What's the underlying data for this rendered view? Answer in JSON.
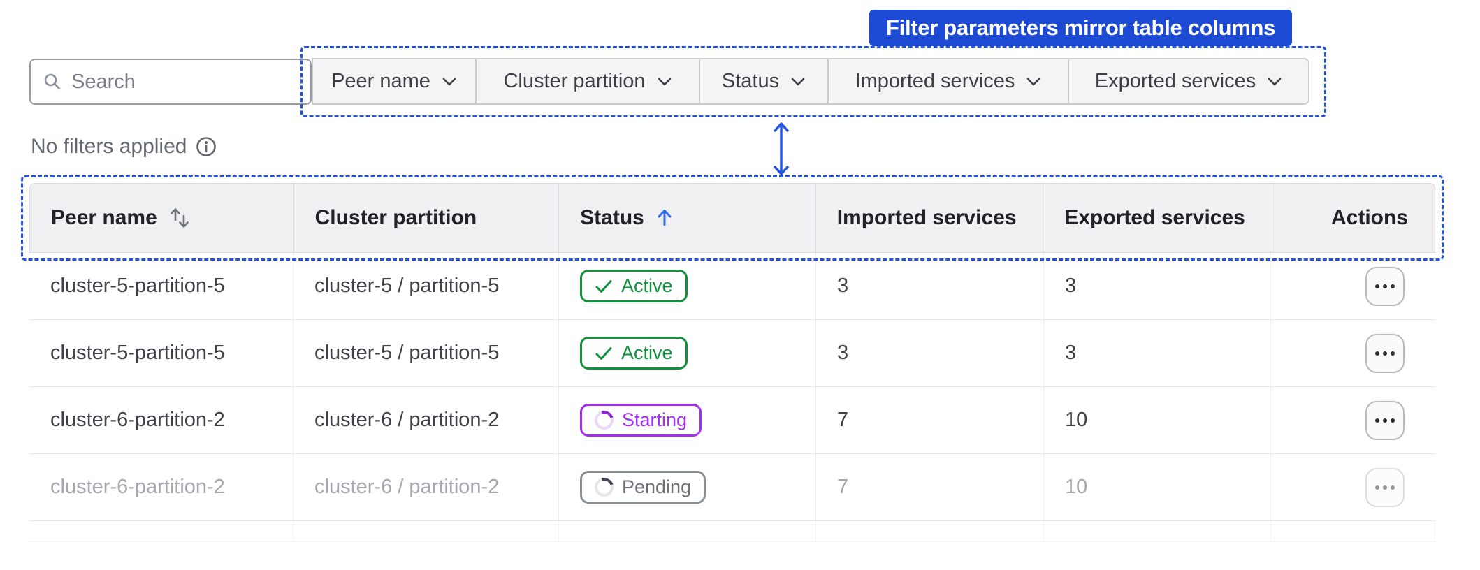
{
  "callout": {
    "label": "Filter parameters mirror table columns",
    "color": "#1d4ad2"
  },
  "search": {
    "placeholder": "Search",
    "value": ""
  },
  "filters": {
    "items": [
      {
        "label": "Peer name"
      },
      {
        "label": "Cluster partition"
      },
      {
        "label": "Status"
      },
      {
        "label": "Imported services"
      },
      {
        "label": "Exported services"
      }
    ],
    "status_text": "No filters applied"
  },
  "icons": {
    "search": "magnifier",
    "info": "info-circle",
    "chevron": "chevron-down",
    "sort_both": "arrows-up-down",
    "sort_asc": "arrow-up",
    "actions": "ellipsis",
    "active": "checkmark",
    "progress": "spinner"
  },
  "table": {
    "columns": [
      {
        "label": "Peer name",
        "sort": "both"
      },
      {
        "label": "Cluster partition",
        "sort": "none"
      },
      {
        "label": "Status",
        "sort": "asc"
      },
      {
        "label": "Imported services",
        "sort": "none"
      },
      {
        "label": "Exported services",
        "sort": "none"
      },
      {
        "label": "Actions",
        "sort": "none"
      }
    ],
    "rows": [
      {
        "peer_name": "cluster-5-partition-5",
        "cluster_partition": "cluster-5 / partition-5",
        "status": {
          "label": "Active",
          "variant": "active"
        },
        "imported": "3",
        "exported": "3",
        "muted": "false"
      },
      {
        "peer_name": "cluster-5-partition-5",
        "cluster_partition": "cluster-5 / partition-5",
        "status": {
          "label": "Active",
          "variant": "active"
        },
        "imported": "3",
        "exported": "3",
        "muted": "false"
      },
      {
        "peer_name": "cluster-6-partition-2",
        "cluster_partition": "cluster-6 / partition-2",
        "status": {
          "label": "Starting",
          "variant": "starting"
        },
        "imported": "7",
        "exported": "10",
        "muted": "false"
      },
      {
        "peer_name": "cluster-6-partition-2",
        "cluster_partition": "cluster-6 / partition-2",
        "status": {
          "label": "Pending",
          "variant": "pending"
        },
        "imported": "7",
        "exported": "10",
        "muted": "true"
      }
    ]
  },
  "colors": {
    "annotation_blue": "#2153dd",
    "status_active": "#12913c",
    "status_starting": "#a32df2",
    "status_pending": "#6d7278",
    "header_bg": "#f0f0f2",
    "filter_bg": "#f4f4f5"
  }
}
